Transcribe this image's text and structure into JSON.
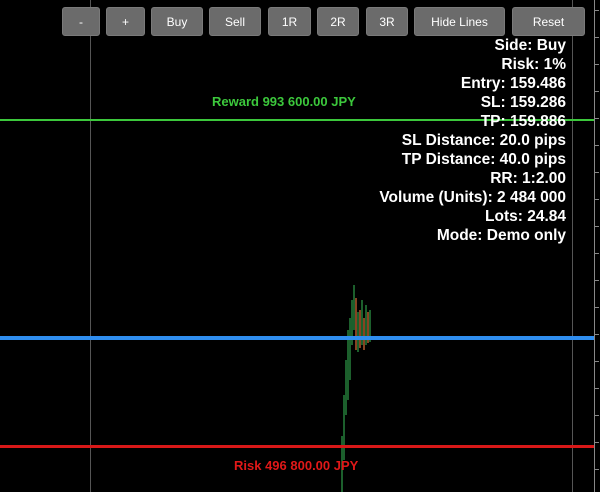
{
  "toolbar": {
    "buttons": [
      {
        "label": "-"
      },
      {
        "label": "+"
      },
      {
        "label": "Buy"
      },
      {
        "label": "Sell"
      },
      {
        "label": "1R"
      },
      {
        "label": "2R"
      },
      {
        "label": "3R"
      },
      {
        "label": "Hide Lines"
      },
      {
        "label": "Reset"
      }
    ]
  },
  "info": {
    "side": "Side: Buy",
    "risk": "Risk: 1%",
    "entry": "Entry: 159.486",
    "sl": "SL: 159.286",
    "tp": "TP: 159.886",
    "sl_distance": "SL Distance: 20.0 pips",
    "tp_distance": "TP Distance: 40.0 pips",
    "rr": "RR: 1:2.00",
    "volume": "Volume (Units): 2 484 000",
    "lots": "Lots: 24.84",
    "mode": "Mode: Demo only"
  },
  "lines": {
    "reward_label": "Reward 993 600.00 JPY",
    "risk_label": "Risk 496 800.00 JPY",
    "tp_color": "#3cc83c",
    "entry_color": "#2f8ef0",
    "sl_color": "#d81818"
  },
  "candles": {
    "up_color": "#2e9e4a",
    "down_color": "#e0703a"
  }
}
